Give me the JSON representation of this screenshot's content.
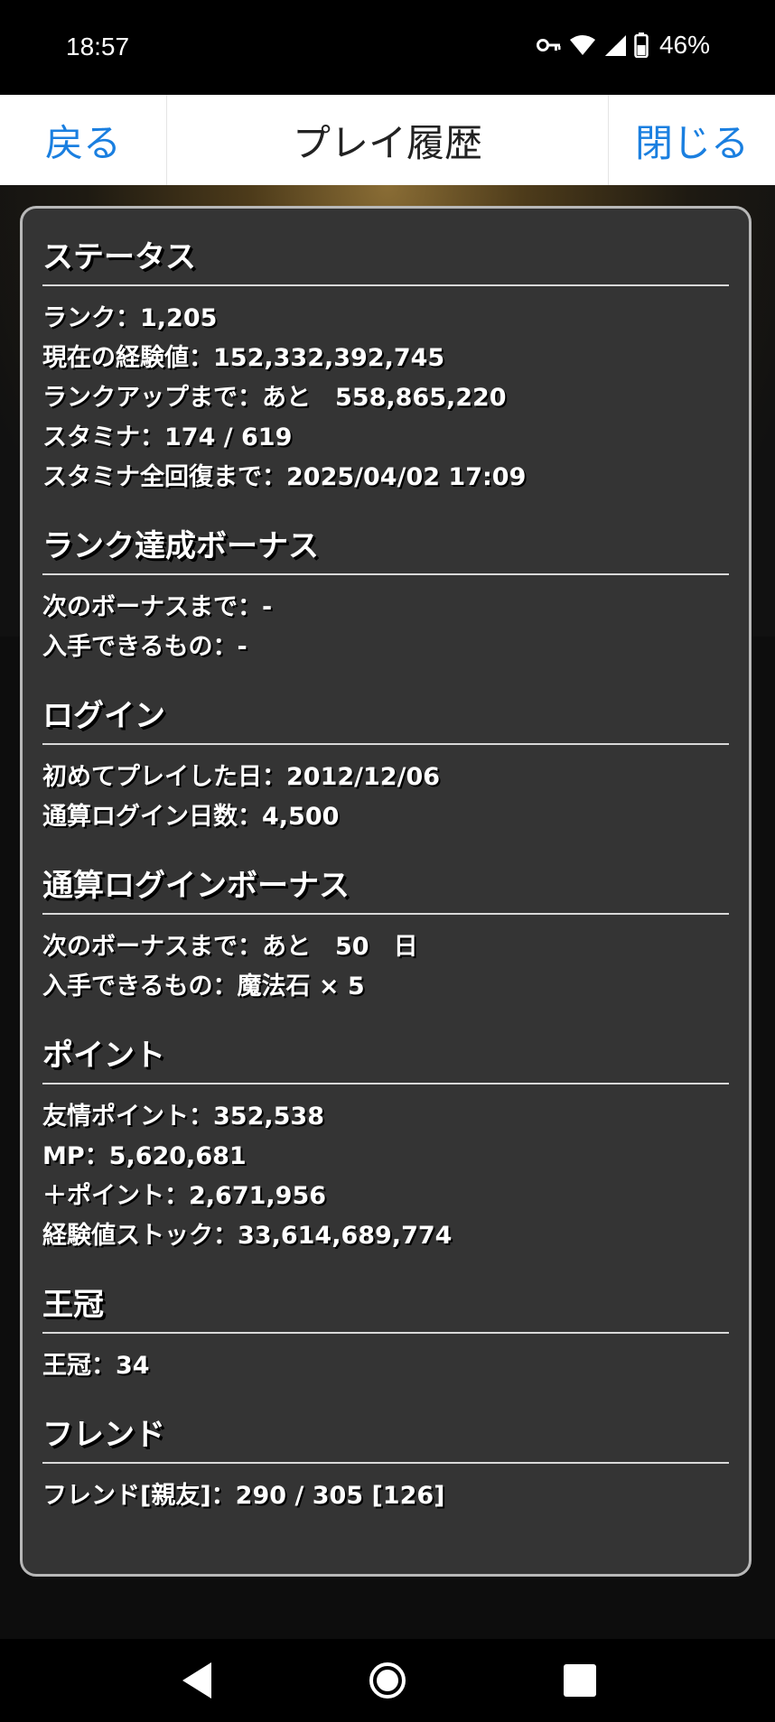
{
  "status_bar": {
    "time": "18:57",
    "battery": "46%",
    "icons": [
      "key-icon",
      "wifi-icon",
      "signal-icon",
      "battery-icon"
    ]
  },
  "header": {
    "back_label": "戻る",
    "title": "プレイ履歴",
    "close_label": "閉じる"
  },
  "sections": {
    "status": {
      "title": "ステータス",
      "rows": [
        "ランク：1,205",
        "現在の経験値：152,332,392,745",
        "ランクアップまで：あと　558,865,220",
        "スタミナ：174 / 619",
        "スタミナ全回復まで：2025/04/02 17:09"
      ]
    },
    "rank_bonus": {
      "title": "ランク達成ボーナス",
      "rows": [
        "次のボーナスまで：-",
        "入手できるもの：-"
      ]
    },
    "login": {
      "title": "ログイン",
      "rows": [
        "初めてプレイした日：2012/12/06",
        "通算ログイン日数：4,500"
      ]
    },
    "login_bonus": {
      "title": "通算ログインボーナス",
      "rows": [
        "次のボーナスまで：あと　50　日",
        "入手できるもの：魔法石 × 5"
      ]
    },
    "points": {
      "title": "ポイント",
      "rows": [
        "友情ポイント：352,538",
        "MP：5,620,681",
        "＋ポイント：2,671,956",
        "経験値ストック：33,614,689,774"
      ]
    },
    "crown": {
      "title": "王冠",
      "rows": [
        "王冠：34"
      ]
    },
    "friends": {
      "title": "フレンド",
      "rows": [
        "フレンド[親友]：290 / 305 [126]"
      ]
    }
  },
  "colors": {
    "accent": "#1a7fe0",
    "panel": "#343434",
    "panel_border": "#b8b8b8"
  },
  "system_nav": [
    "back-icon",
    "home-icon",
    "recents-icon"
  ]
}
